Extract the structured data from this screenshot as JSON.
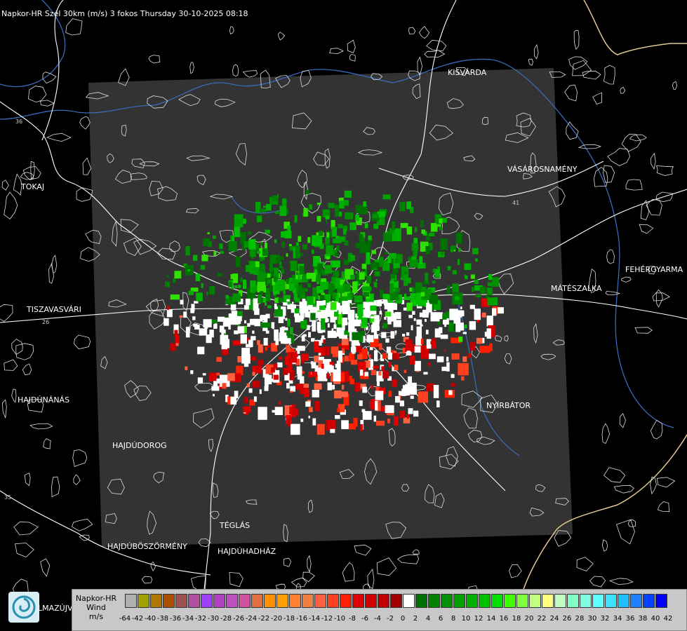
{
  "title": "Napkor-HR Szél 30km (m/s) 3 fokos Thursday 30-10-2025 08:18",
  "cities": [
    {
      "id": "tokaj",
      "name": "TOKAJ"
    },
    {
      "id": "kisvarda",
      "name": "KISVÁRDA"
    },
    {
      "id": "vasarosnameny",
      "name": "VÁSÁROSNAMÉNY"
    },
    {
      "id": "tiszavasvari",
      "name": "TISZAVASVÁRI"
    },
    {
      "id": "mateszalka",
      "name": "MÁTÉSZALKA"
    },
    {
      "id": "fehergyarmat",
      "name": "FEHÉRGYARMA"
    },
    {
      "id": "hajdunanas",
      "name": "HAJDÚNÁNÁS"
    },
    {
      "id": "nyirbator",
      "name": "NYÍRBÁTOR"
    },
    {
      "id": "hajdudorog",
      "name": "HAJDÚDOROG"
    },
    {
      "id": "teglas",
      "name": "TÉGLÁS"
    },
    {
      "id": "hajduboszormeny",
      "name": "HAJDÚBÖSZÖRMÉNY"
    },
    {
      "id": "hajduhadhaz",
      "name": "HAJDÚHADHÁZ"
    }
  ],
  "road_labels": [
    "36",
    "41",
    "35",
    "26"
  ],
  "logo_text": "LMAZÚJVÁR",
  "legend": {
    "title_lines": [
      "Napkor-HR",
      "Wind",
      "m/s"
    ],
    "ticks": [
      "-64",
      "-42",
      "-40",
      "-38",
      "-36",
      "-34",
      "-32",
      "-30",
      "-28",
      "-26",
      "-24",
      "-22",
      "-20",
      "-18",
      "-16",
      "-14",
      "-12",
      "-10",
      "-8",
      "-6",
      "-4",
      "-2",
      "0",
      "2",
      "4",
      "6",
      "8",
      "10",
      "12",
      "14",
      "16",
      "18",
      "20",
      "22",
      "24",
      "26",
      "28",
      "30",
      "32",
      "34",
      "36",
      "38",
      "40",
      "42"
    ],
    "colors": [
      "#b0b0b0",
      "#a0a000",
      "#b07800",
      "#a85000",
      "#a05050",
      "#b050a0",
      "#a040ff",
      "#b040c0",
      "#c050c0",
      "#d050a0",
      "#e07040",
      "#ff9000",
      "#ffa000",
      "#ff8030",
      "#f08040",
      "#ff6040",
      "#ff4020",
      "#ff2000",
      "#e00000",
      "#d00000",
      "#c00000",
      "#a00000",
      "#ffffff",
      "#007000",
      "#008000",
      "#009000",
      "#00a000",
      "#00b000",
      "#00c000",
      "#00e000",
      "#40ff00",
      "#80ff40",
      "#c0ff80",
      "#ffff80",
      "#c0ffc0",
      "#80ffc0",
      "#80ffe0",
      "#60ffff",
      "#40e0ff",
      "#20c0ff",
      "#2080ff",
      "#0040ff",
      "#0000ff"
    ]
  }
}
